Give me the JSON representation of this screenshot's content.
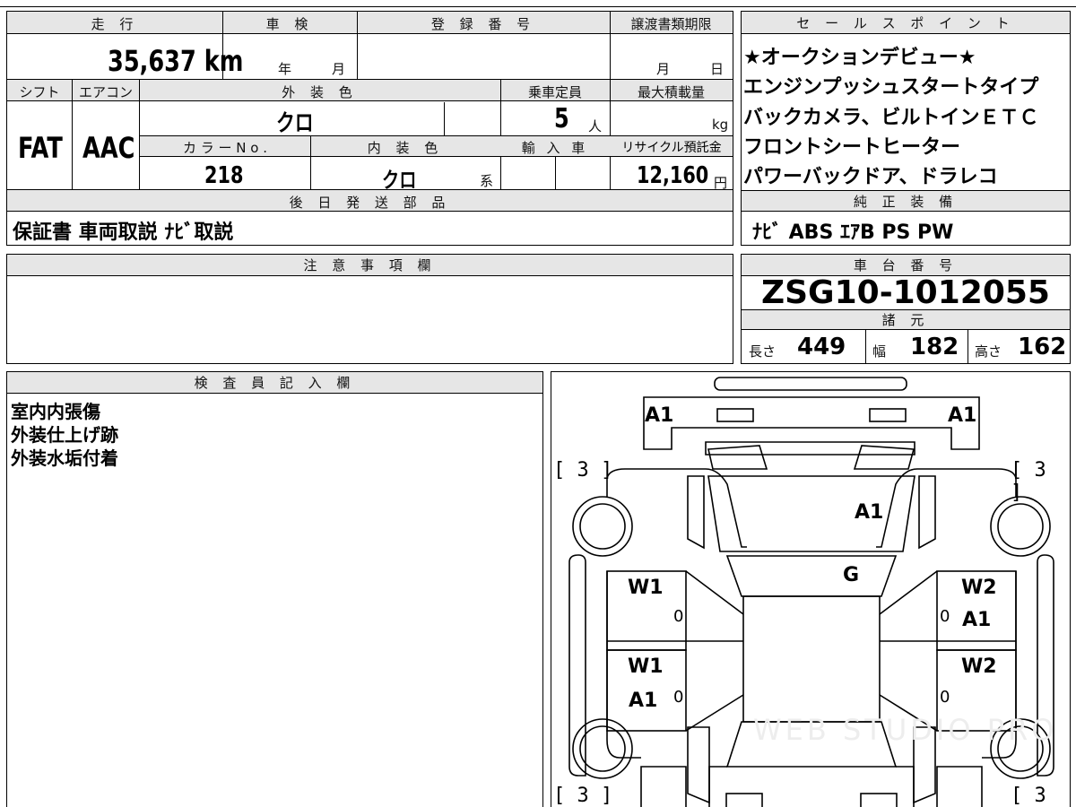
{
  "top": {
    "mileage_label": "走 行",
    "shaken_label": "車 検",
    "reg_label": "登 録 番 号",
    "transfer_label": "譲渡書類期限",
    "mileage_value": "35,637 km",
    "shaken_year": "年",
    "shaken_month": "月",
    "transfer_month": "月",
    "transfer_day": "日",
    "shift_label": "シフト",
    "ac_label": "エアコン",
    "exterior_label": "外 装 色",
    "capacity_label": "乗車定員",
    "maxload_label": "最大積載量",
    "shift_value": "FAT",
    "ac_value": "AAC",
    "exterior_value": "クロ",
    "capacity_value": "5",
    "capacity_unit": "人",
    "maxload_unit": "kg",
    "colorno_label": "カ ラ ー N o .",
    "interior_label": "内 装 色",
    "import_label": "輸 入 車",
    "recycle_label": "リサイクル預託金",
    "colorno_value": "218",
    "interior_value": "クロ",
    "interior_unit": "系",
    "recycle_value": "12,160",
    "recycle_unit": "円",
    "later_label": "後 日 発 送 部 品",
    "later_value": "保証書 車両取説 ﾅﾋﾞ取説"
  },
  "sales": {
    "header": "セ ー ル ス ポ イ ン ト",
    "points": [
      "★オークションデビュー★",
      "エンジンプッシュスタートタイプ",
      "バックカメラ、ビルトインＥＴＣ",
      "フロントシートヒーター",
      "パワーバックドア、ドラレコ"
    ],
    "equip_header": "純 正 装 備",
    "equip_value": "ﾅﾋﾞ ABS ｴｱB PS PW"
  },
  "notes": {
    "header": "注 意 事 項 欄"
  },
  "chassis": {
    "header": "車 台 番 号",
    "value": "ZSG10-1012055",
    "spec_header": "諸 元",
    "length_label": "長さ",
    "length_value": "449",
    "width_label": "幅",
    "width_value": "182",
    "height_label": "高さ",
    "height_value": "162"
  },
  "inspector": {
    "header": "検 査 員 記 入 欄",
    "lines": [
      "室内内張傷",
      "外装仕上げ跡",
      "外装水垢付着"
    ]
  },
  "diagram": {
    "marks": {
      "front_left": "A1",
      "front_right": "A1",
      "hood": "A1",
      "windshield": "G",
      "fl_door_top": "W1",
      "fl_door_zero": "0",
      "fr_door_top": "W2",
      "fr_door_zero": "0",
      "fr_door_bottom": "A1",
      "rl_door_top": "W1",
      "rl_door_bottom": "A1",
      "rl_door_zero": "0",
      "rr_door_top": "W2",
      "rr_door_zero": "0",
      "tire_fl": "[ 3 ]",
      "tire_fr": "[ 3 ]",
      "tire_rl": "[ 3 ]",
      "tire_rr": "[ 3 ]"
    },
    "watermark": "WEB STUDIO PRO"
  }
}
